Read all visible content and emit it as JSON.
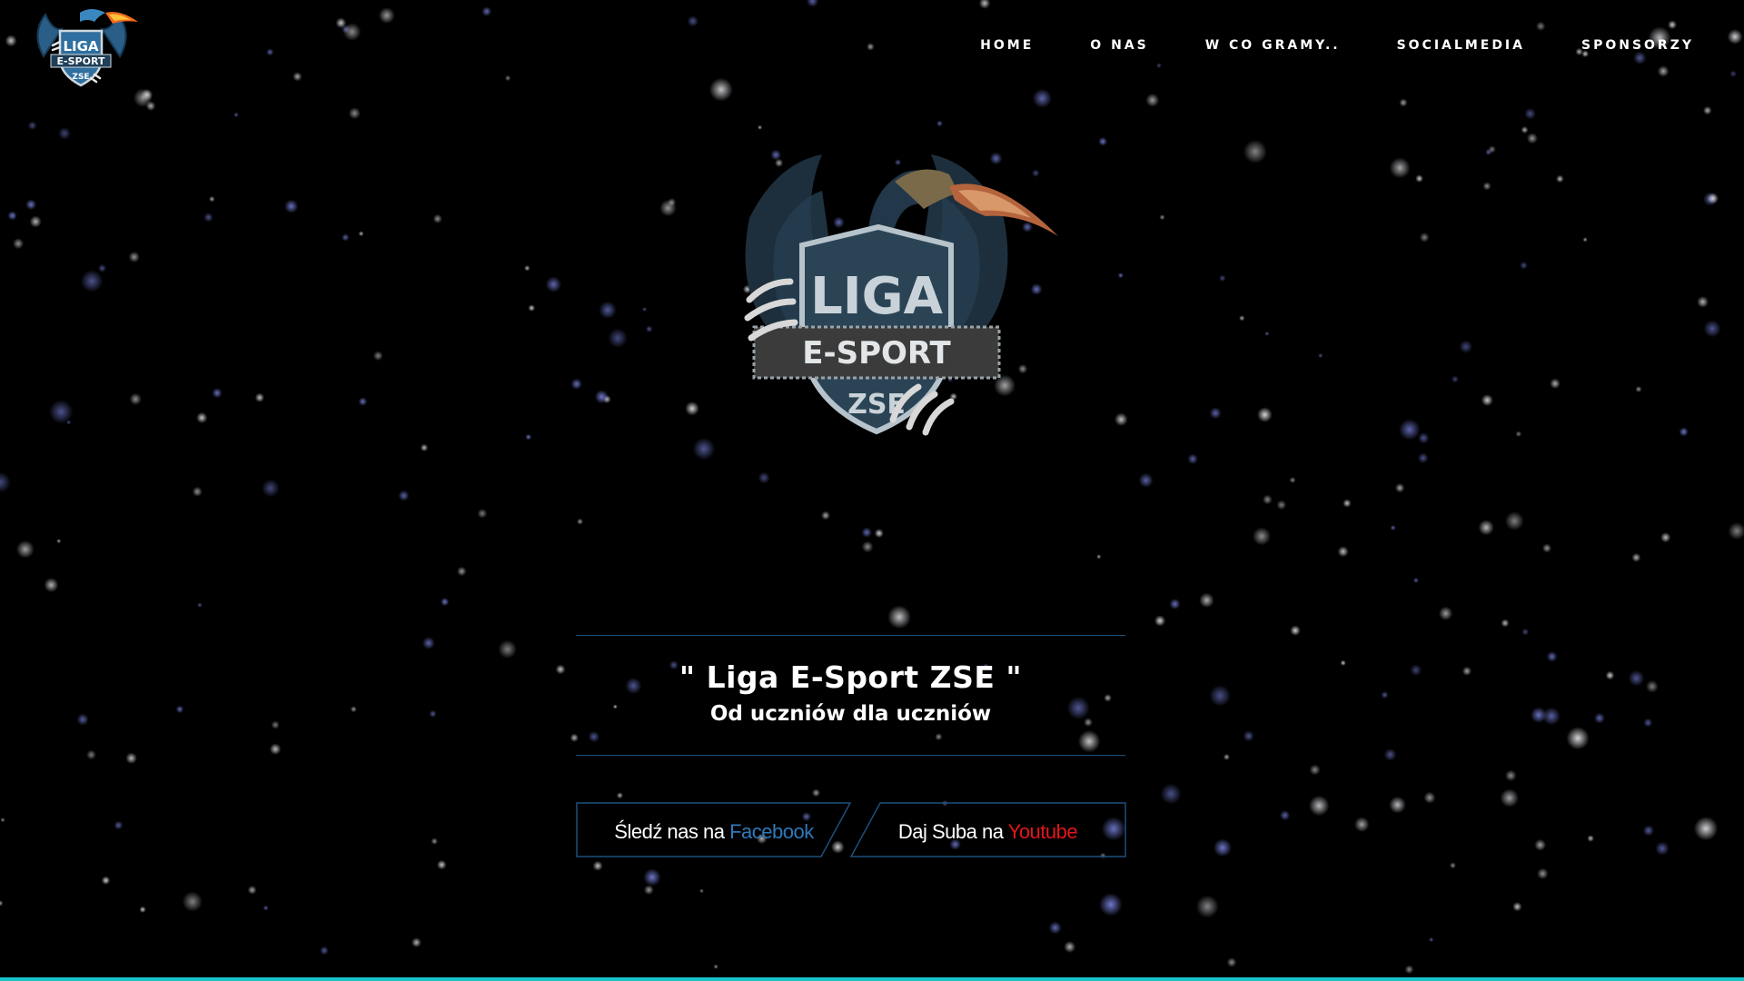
{
  "colors": {
    "background": "#000000",
    "accent_line": "#1d4f7c",
    "facebook": "#2f79b8",
    "youtube": "#e3161c",
    "bottom_bar": "#17c3c9"
  },
  "header": {
    "logo": {
      "icon": "dragon-shield-logo",
      "line1": "LIGA",
      "line2": "E-SPORT",
      "line3": "ZSE"
    },
    "nav": [
      {
        "label": "HOME"
      },
      {
        "label": "O NAS"
      },
      {
        "label": "W CO GRAMY.."
      },
      {
        "label": "SOCIALMEDIA"
      },
      {
        "label": "SPONSORZY"
      }
    ]
  },
  "hero": {
    "emblem": {
      "icon": "dragon-shield-emblem",
      "line1": "LIGA",
      "line2": "E-SPORT",
      "line3": "ZSE"
    },
    "title": "\" Liga E-Sport ZSE \"",
    "subtitle": "Od uczniów dla uczniów"
  },
  "cta": {
    "facebook": {
      "prefix": "Śledź nas na ",
      "link": "Facebook"
    },
    "youtube": {
      "prefix": "Daj Suba na ",
      "link": "Youtube"
    }
  }
}
